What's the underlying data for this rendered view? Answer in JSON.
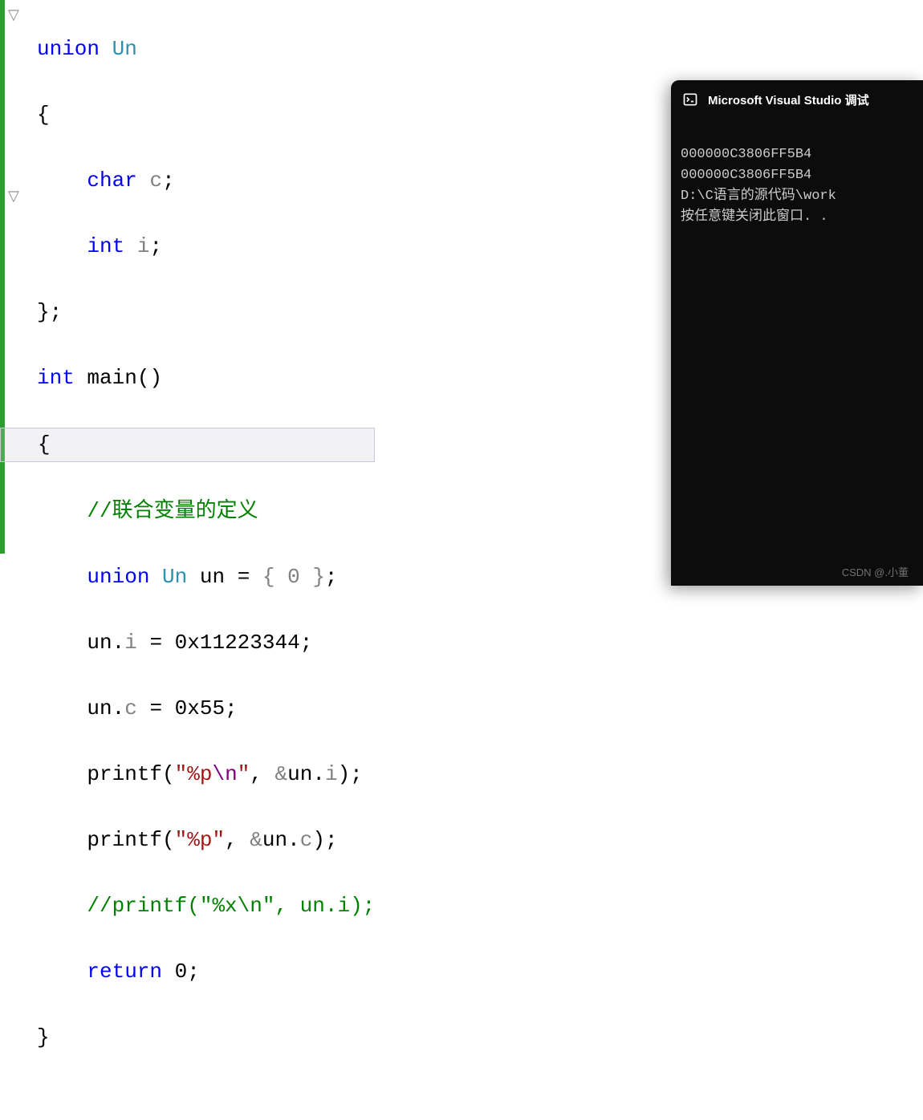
{
  "code": {
    "line1": {
      "kw1": "union",
      "type": "Un"
    },
    "line2": "{",
    "line3": {
      "kw": "char",
      "var": "c",
      "semi": ";"
    },
    "line4": {
      "kw": "int",
      "var": "i",
      "semi": ";"
    },
    "line5": {
      "close": "}",
      "semi": ";"
    },
    "line6": {
      "kw": "int",
      "fn": "main",
      "paren": "()"
    },
    "line7": "{",
    "line8_comment": "//联合变量的定义",
    "line9": {
      "kw": "union",
      "type": "Un",
      "var": "un",
      "eq": " = ",
      "brace": "{ 0 }",
      "semi": ";"
    },
    "line10": {
      "var": "un",
      "dot": ".",
      "mem": "i",
      "eq": " = ",
      "val": "0x11223344",
      "semi": ";"
    },
    "line11": {
      "var": "un",
      "dot": ".",
      "mem": "c",
      "eq": " = ",
      "val": "0x55",
      "semi": ";"
    },
    "line12": {
      "fn": "printf",
      "open": "(",
      "str1": "\"%p",
      "esc": "\\n",
      "str2": "\"",
      "comma": ", ",
      "amp": "&",
      "var": "un",
      "dot": ".",
      "mem": "i",
      "close": ")",
      "semi": ";"
    },
    "line13": {
      "fn": "printf",
      "open": "(",
      "str": "\"%p\"",
      "comma": ", ",
      "amp": "&",
      "var": "un",
      "dot": ".",
      "mem": "c",
      "close": ")",
      "semi": ";"
    },
    "line14_comment": "//printf(\"%x\\n\", un.i);",
    "line15": {
      "kw": "return",
      "val": "0",
      "semi": ";"
    },
    "line16": "}"
  },
  "console": {
    "title": "Microsoft Visual Studio 调试",
    "line1": "000000C3806FF5B4",
    "line2": "000000C3806FF5B4",
    "line3": "D:\\C语言的源代码\\work",
    "line4": "按任意键关闭此窗口. ."
  },
  "watermark": "CSDN @.小董"
}
